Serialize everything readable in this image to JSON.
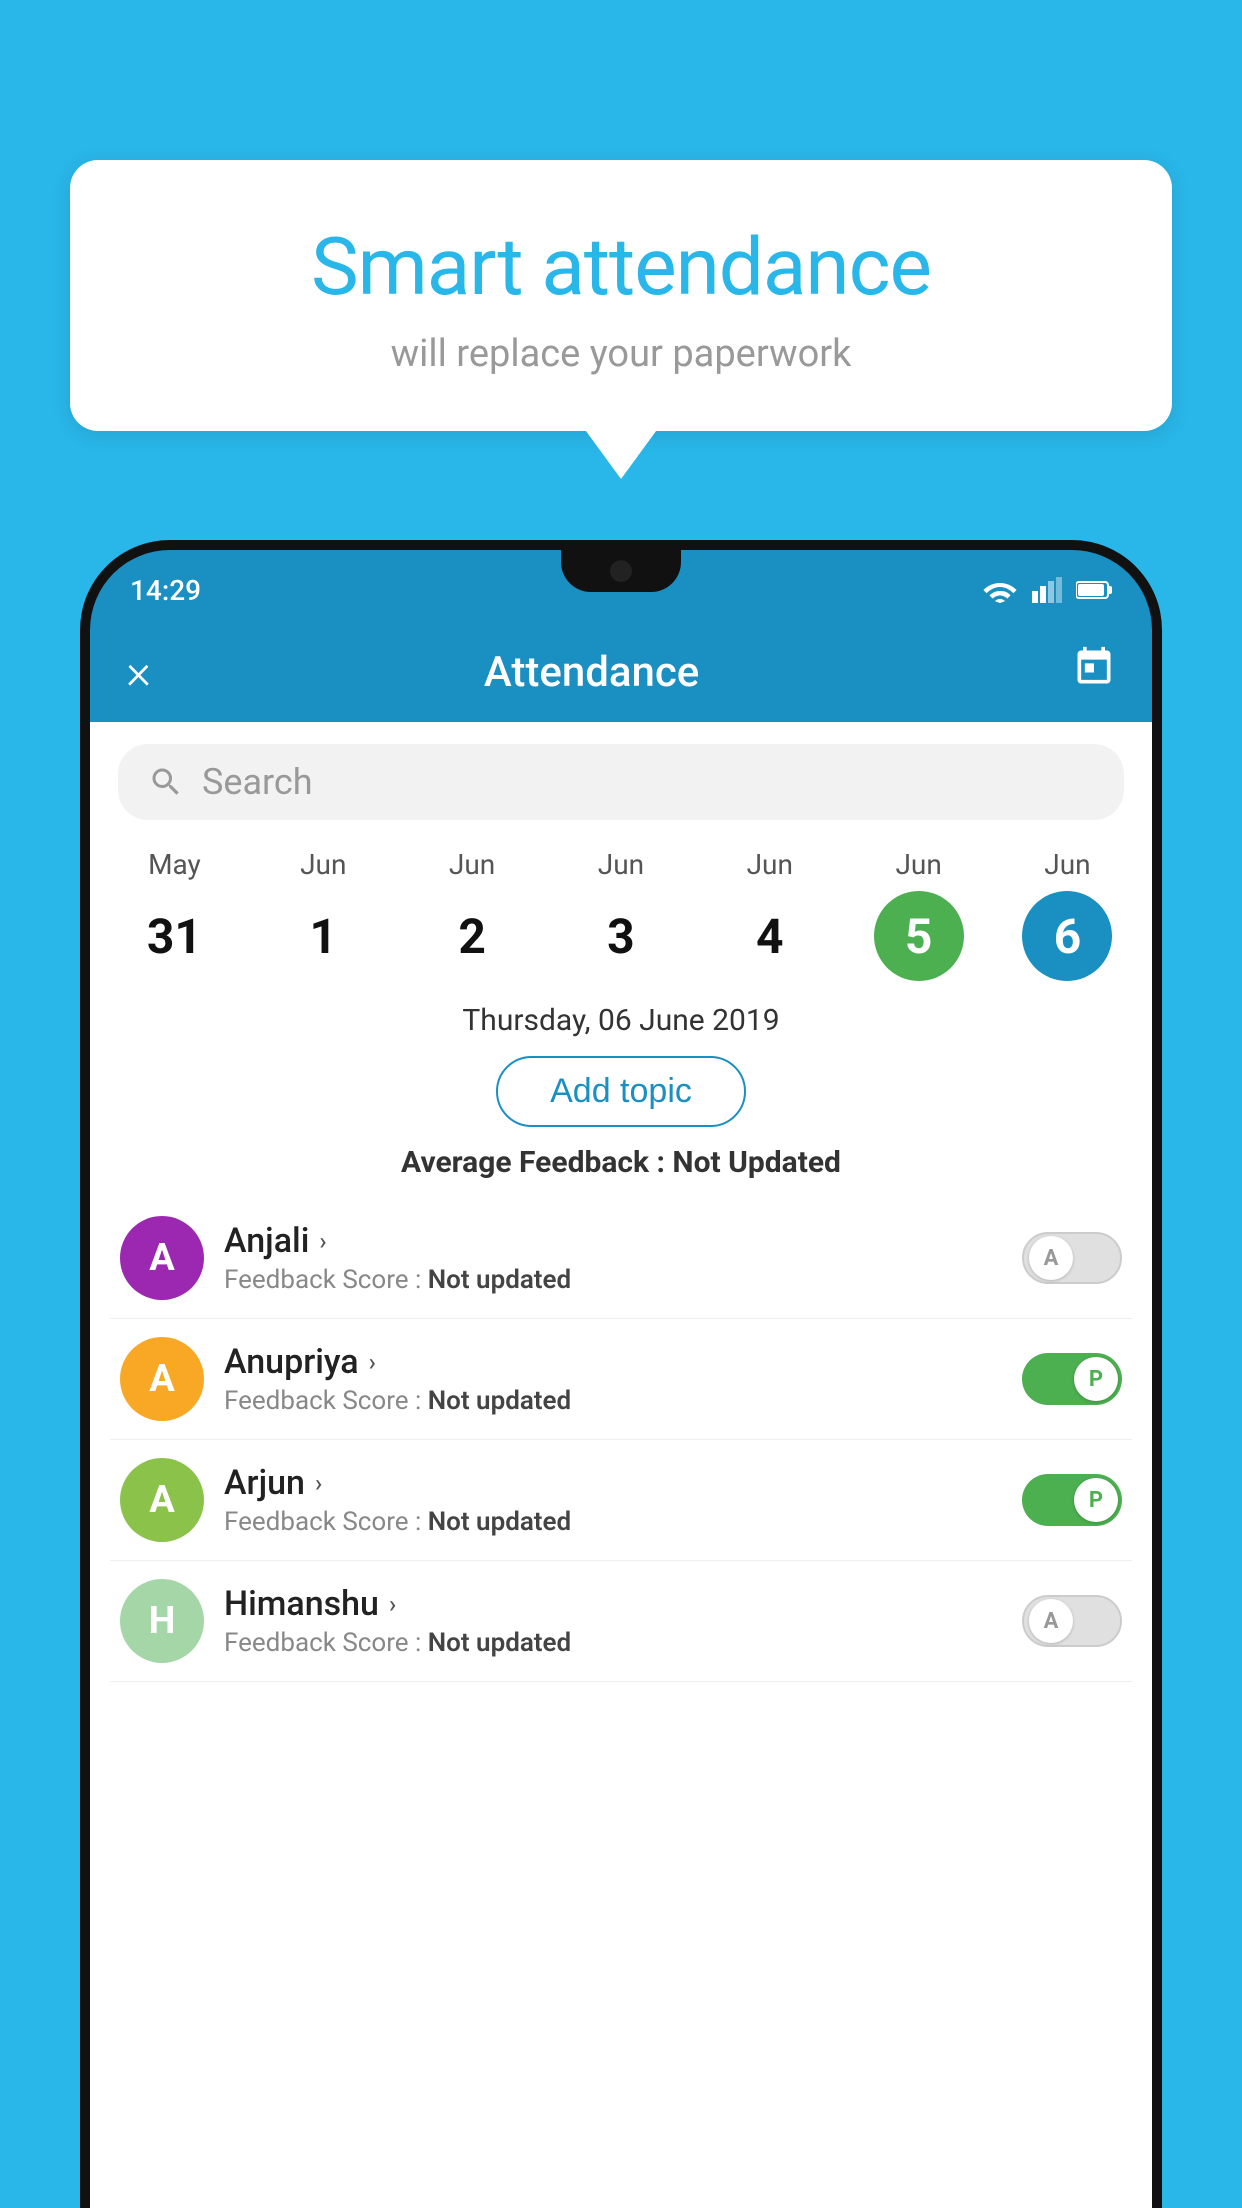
{
  "background_color": "#29b6e8",
  "speech_bubble": {
    "title": "Smart attendance",
    "subtitle": "will replace your paperwork"
  },
  "status_bar": {
    "time": "14:29"
  },
  "app_bar": {
    "title": "Attendance",
    "close_label": "×"
  },
  "search": {
    "placeholder": "Search"
  },
  "calendar": {
    "days": [
      {
        "month": "May",
        "date": "31",
        "state": "normal"
      },
      {
        "month": "Jun",
        "date": "1",
        "state": "normal"
      },
      {
        "month": "Jun",
        "date": "2",
        "state": "normal"
      },
      {
        "month": "Jun",
        "date": "3",
        "state": "normal"
      },
      {
        "month": "Jun",
        "date": "4",
        "state": "normal"
      },
      {
        "month": "Jun",
        "date": "5",
        "state": "today"
      },
      {
        "month": "Jun",
        "date": "6",
        "state": "selected"
      }
    ]
  },
  "selected_date_label": "Thursday, 06 June 2019",
  "add_topic_label": "Add topic",
  "avg_feedback": {
    "label": "Average Feedback :",
    "value": "Not Updated"
  },
  "students": [
    {
      "name": "Anjali",
      "avatar_letter": "A",
      "avatar_color": "#9c27b0",
      "feedback_label": "Feedback Score :",
      "feedback_value": "Not updated",
      "toggle_state": "off",
      "toggle_letter": "A"
    },
    {
      "name": "Anupriya",
      "avatar_letter": "A",
      "avatar_color": "#f9a825",
      "feedback_label": "Feedback Score :",
      "feedback_value": "Not updated",
      "toggle_state": "on",
      "toggle_letter": "P"
    },
    {
      "name": "Arjun",
      "avatar_letter": "A",
      "avatar_color": "#8bc34a",
      "feedback_label": "Feedback Score :",
      "feedback_value": "Not updated",
      "toggle_state": "on",
      "toggle_letter": "P"
    },
    {
      "name": "Himanshu",
      "avatar_letter": "H",
      "avatar_color": "#a5d6a7",
      "feedback_label": "Feedback Score :",
      "feedback_value": "Not updated",
      "toggle_state": "off",
      "toggle_letter": "A"
    }
  ]
}
